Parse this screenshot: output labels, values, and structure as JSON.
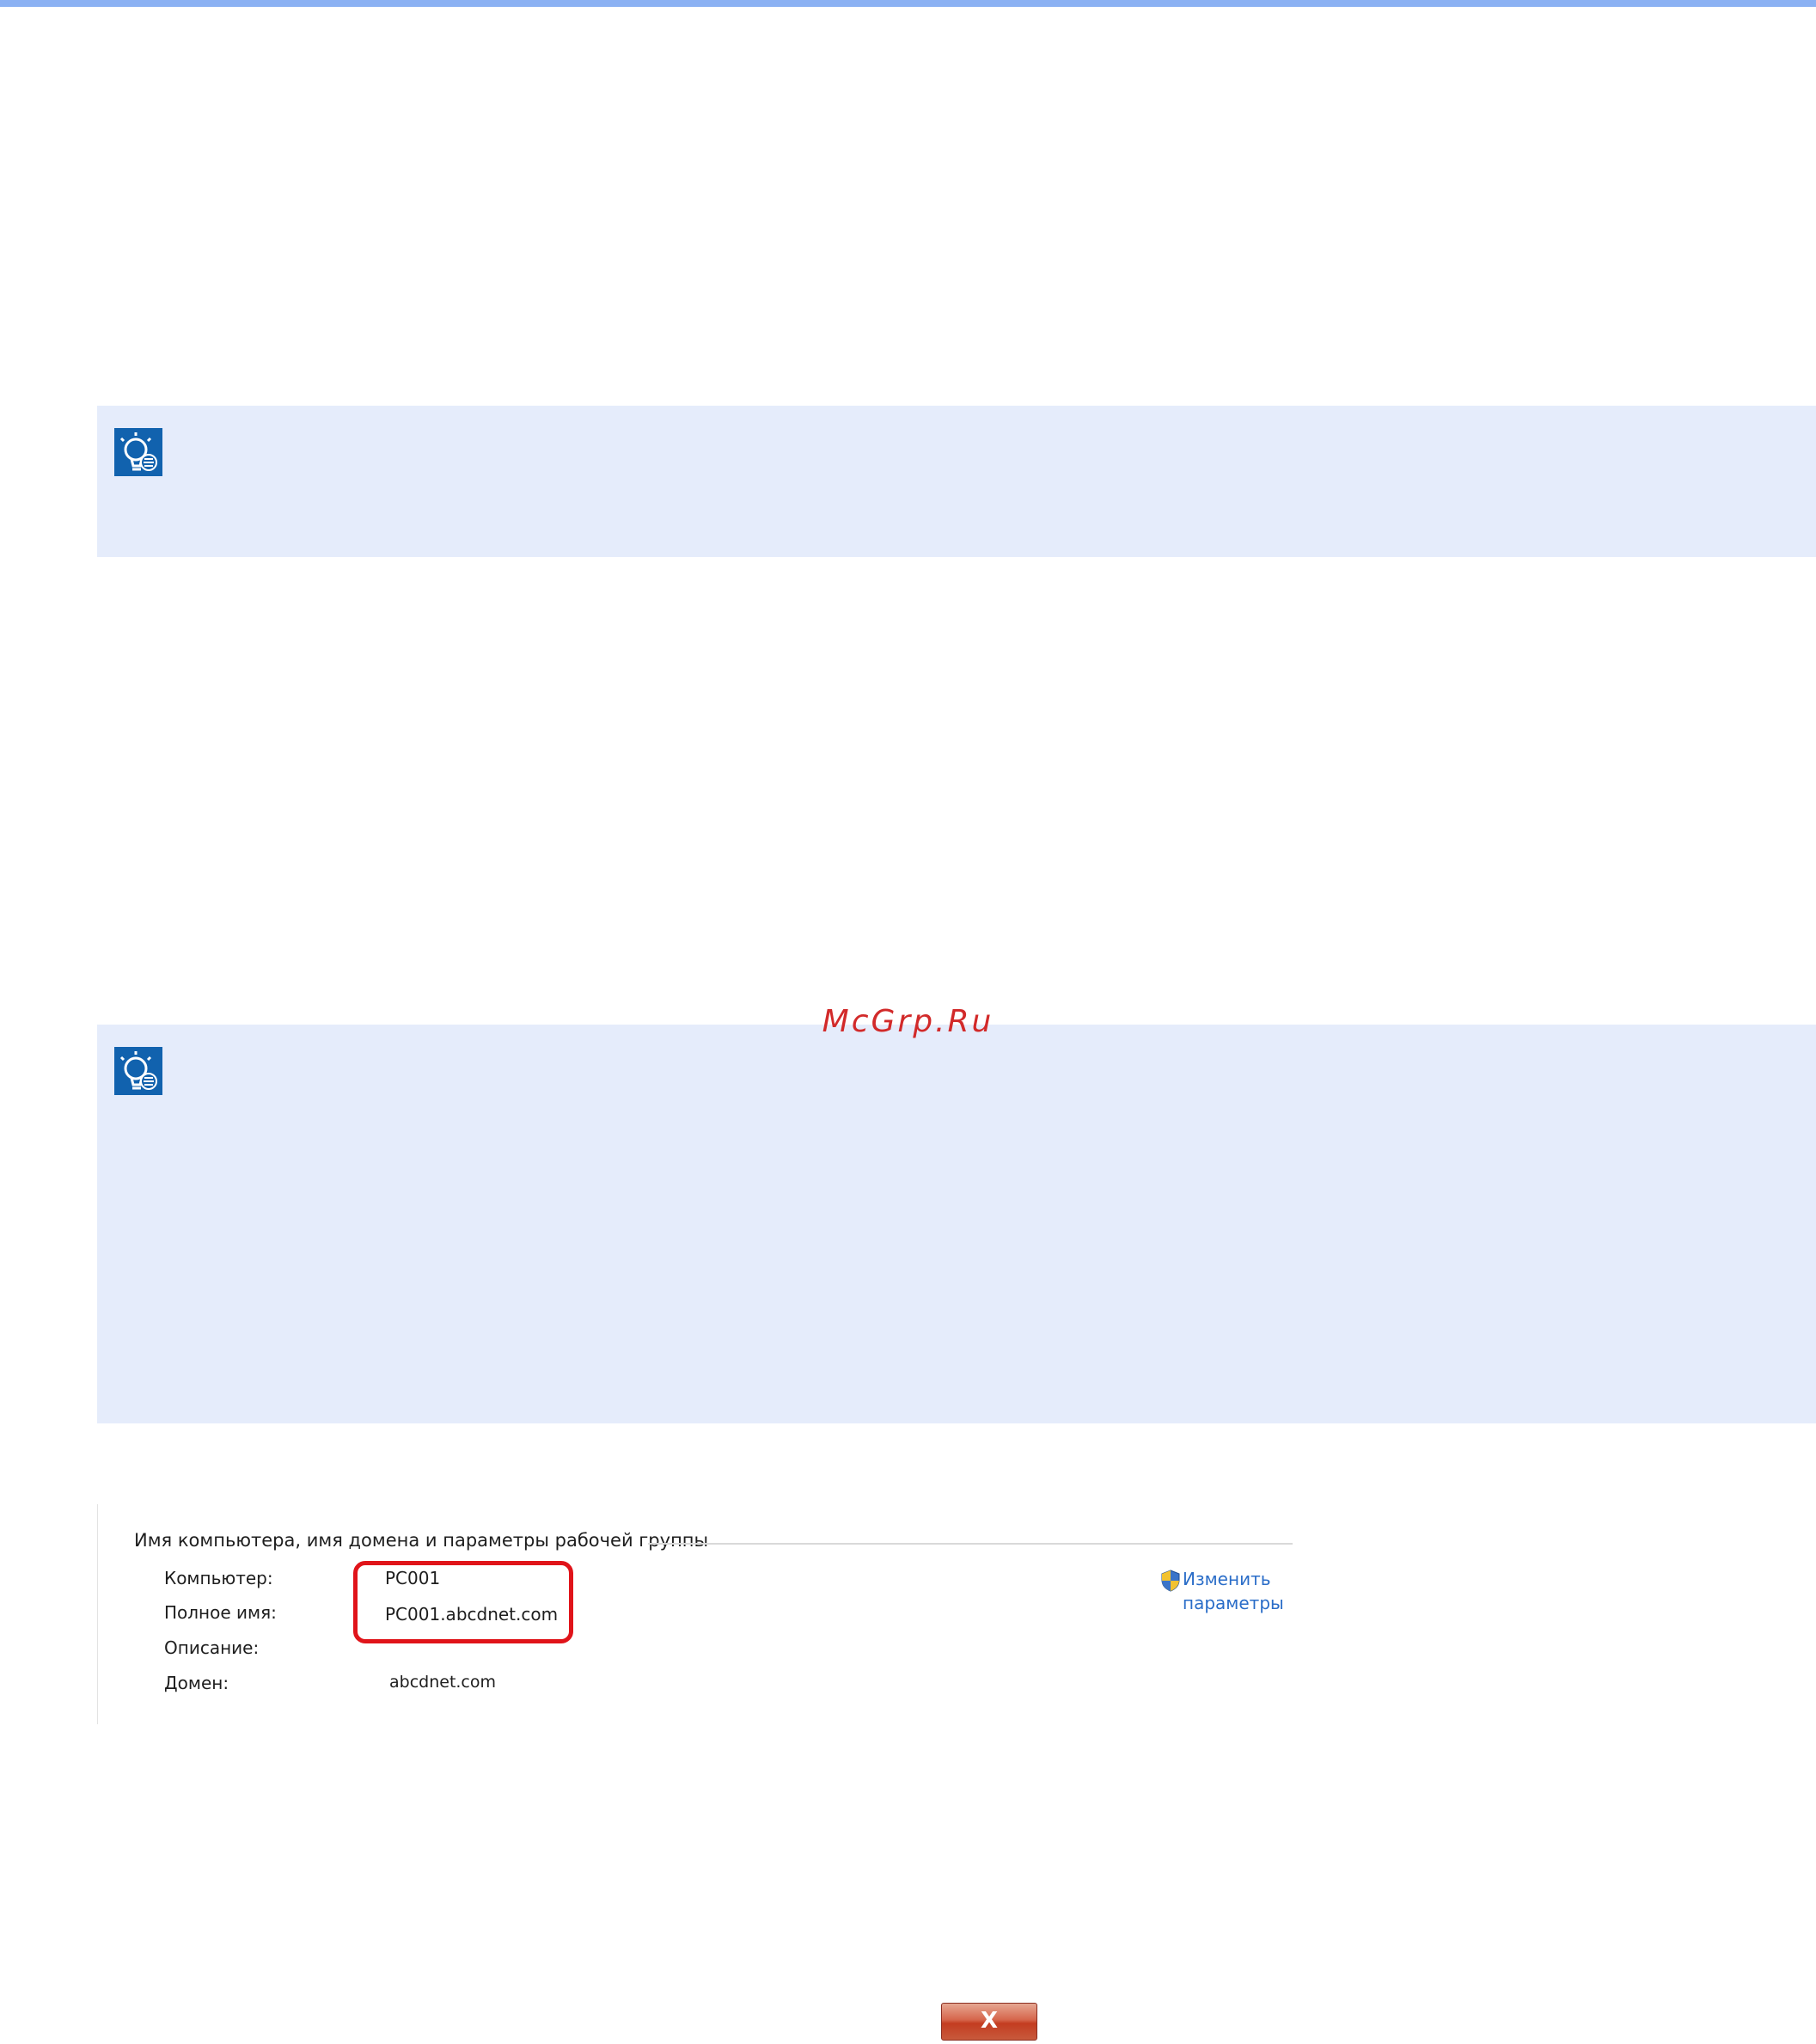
{
  "watermark": "McGrp.Ru",
  "notes": [
    {
      "icon": "lightbulb-hint-icon"
    },
    {
      "icon": "lightbulb-hint-icon"
    }
  ],
  "system_info": {
    "header": "Имя компьютера, имя домена и параметры рабочей группы",
    "rows": [
      {
        "label": "Компьютер:",
        "value": "PC001"
      },
      {
        "label": "Полное имя:",
        "value": "PC001.abcdnet.com"
      },
      {
        "label": "Описание:",
        "value": ""
      },
      {
        "label": "Домен:",
        "value": "abcdnet.com"
      }
    ],
    "change_link_line1": "Изменить",
    "change_link_line2": "параметры",
    "highlight_color": "#e0141a",
    "link_color": "#2a6dc8"
  },
  "close_button": {
    "label": "X",
    "icon": "close-icon"
  },
  "colors": {
    "top_rule": "#8bb1f3",
    "note_background": "#e5ecfb",
    "icon_blue": "#1162ae"
  }
}
